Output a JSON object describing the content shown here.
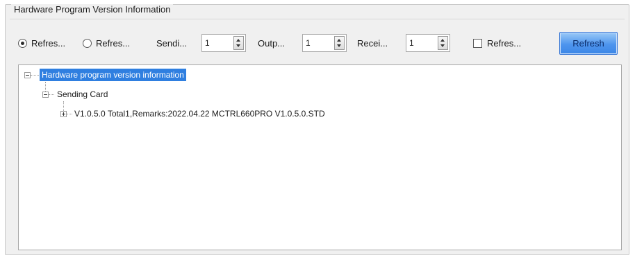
{
  "group": {
    "title": "Hardware Program Version Information"
  },
  "toolbar": {
    "radio1_label": "Refres...",
    "radio2_label": "Refres...",
    "sending_label": "Sendi...",
    "sending_value": "1",
    "output_label": "Outp...",
    "output_value": "1",
    "receiving_label": "Recei...",
    "receiving_value": "1",
    "checkbox_label": "Refres...",
    "refresh_button": "Refresh"
  },
  "tree": {
    "root_label": "Hardware program version information",
    "child_label": "Sending Card",
    "leaf_label": "V1.0.5.0 Total1,Remarks:2022.04.22 MCTRL660PRO V1.0.5.0.STD"
  },
  "colors": {
    "selection": "#2f7fe0",
    "button": "#4e95ee"
  }
}
